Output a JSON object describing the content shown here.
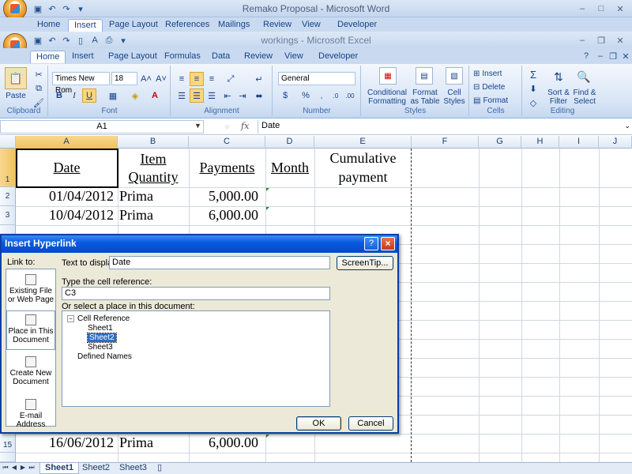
{
  "word": {
    "title": "Remako Proposal - Microsoft Word",
    "tabs": [
      "Home",
      "Insert",
      "Page Layout",
      "References",
      "Mailings",
      "Review",
      "View",
      "Developer"
    ],
    "active_tab": "Insert"
  },
  "excel": {
    "title": "workings - Microsoft Excel",
    "tabs": [
      "Home",
      "Insert",
      "Page Layout",
      "Formulas",
      "Data",
      "Review",
      "View",
      "Developer"
    ],
    "active_tab": "Home",
    "ribbon": {
      "clipboard": {
        "paste": "Paste",
        "label": "Clipboard"
      },
      "font": {
        "name": "Times New Rom",
        "size": "18",
        "label": "Font",
        "bold": "B",
        "italic": "I",
        "underline": "U"
      },
      "alignment": {
        "label": "Alignment"
      },
      "number": {
        "format": "General",
        "label": "Number",
        "currency": "$",
        "percent": "%"
      },
      "styles": {
        "label": "Styles",
        "conditional": "Conditional Formatting",
        "format_table": "Format as Table",
        "cell_styles": "Cell Styles"
      },
      "cells": {
        "label": "Cells",
        "insert": "Insert",
        "delete": "Delete",
        "format": "Format"
      },
      "editing": {
        "label": "Editing",
        "sort": "Sort & Filter",
        "find": "Find & Select"
      }
    },
    "namebox": "A1",
    "fx": "fx",
    "formula": "Date",
    "columns": [
      "A",
      "B",
      "C",
      "D",
      "E",
      "F",
      "G",
      "H",
      "I",
      "J"
    ],
    "rows": [
      "1",
      "2",
      "3",
      "15"
    ],
    "header_row": {
      "a": "Date",
      "b": "Item Quantity",
      "c": "Payments",
      "d": "Month",
      "e": "Cumulative payment"
    },
    "data_rows": [
      {
        "date": "01/04/2012",
        "item": "Prima",
        "payment": "5,000.00"
      },
      {
        "date": "10/04/2012",
        "item": "Prima",
        "payment": "6,000.00"
      },
      {
        "date": "16/06/2012",
        "item": "Prima",
        "payment": "6,000.00"
      }
    ],
    "sheets": [
      "Sheet1",
      "Sheet2",
      "Sheet3"
    ],
    "active_sheet": "Sheet1"
  },
  "dialog": {
    "title": "Insert Hyperlink",
    "help": "?",
    "close": "×",
    "link_to": "Link to:",
    "link_options": [
      "Existing File or Web Page",
      "Place in This Document",
      "Create New Document",
      "E-mail Address"
    ],
    "text_to_display_label": "Text to display:",
    "text_to_display_value": "Date",
    "screentip": "ScreenTip...",
    "cell_ref_label": "Type the cell reference:",
    "cell_ref_value": "C3",
    "place_label": "Or select a place in this document:",
    "tree": {
      "cell_reference": "Cell Reference",
      "sheets": [
        "Sheet1",
        "Sheet2",
        "Sheet3"
      ],
      "selected": "Sheet2",
      "defined_names": "Defined Names"
    },
    "ok": "OK",
    "cancel": "Cancel"
  }
}
